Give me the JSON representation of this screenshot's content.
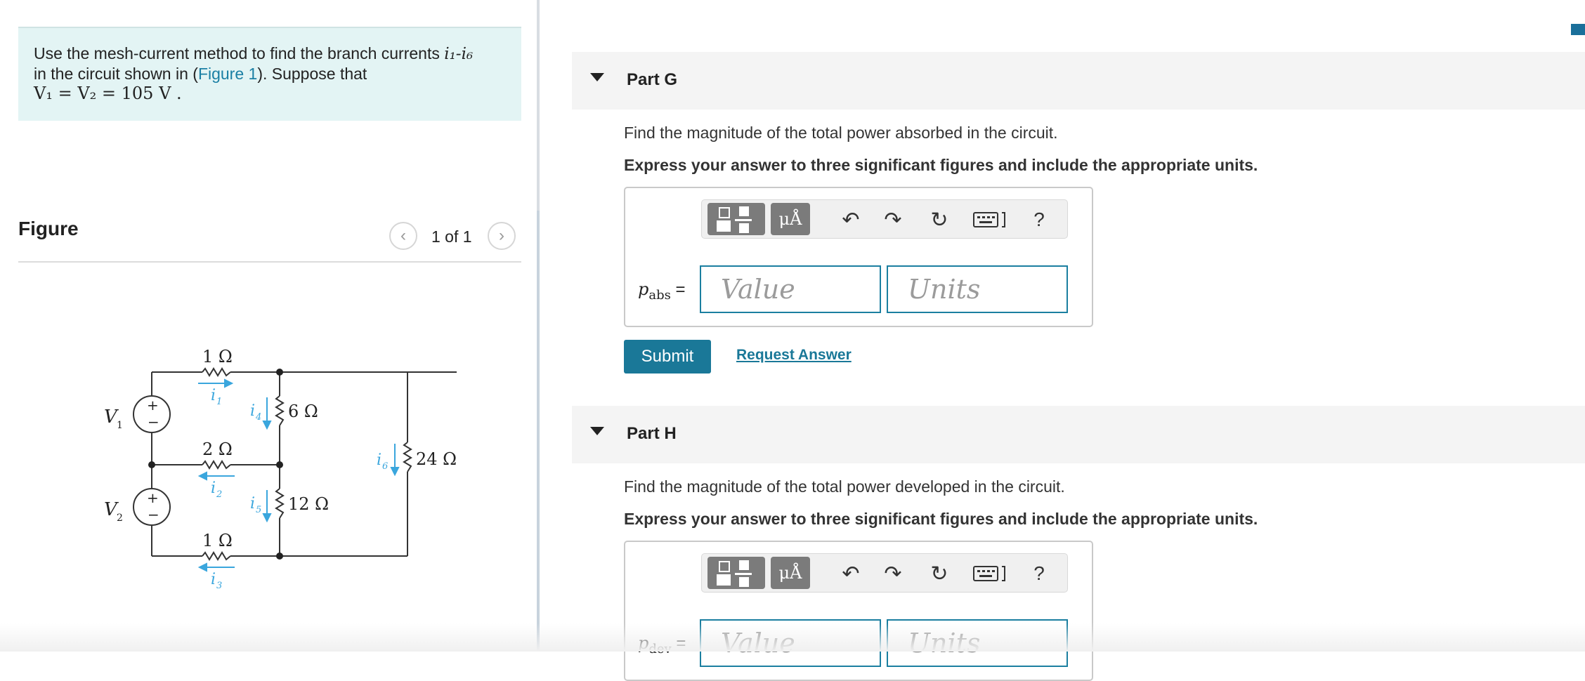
{
  "problem": {
    "text_before": "Use the mesh-current method to find the branch currents ",
    "currents_range": "i₁-i₆",
    "line2_before": "in the circuit shown in (",
    "figure_link": "Figure 1",
    "line2_after": "). Suppose that",
    "condition": "V₁ = V₂ = 105  V ."
  },
  "figure": {
    "title": "Figure",
    "counter": "1 of 1",
    "prev_icon": "chevron-left-icon",
    "next_icon": "chevron-right-icon",
    "circuit": {
      "labels": {
        "r1": "1 Ω",
        "r2": "2 Ω",
        "r3": "1 Ω",
        "r4": "6 Ω",
        "r5": "12 Ω",
        "r6": "24 Ω",
        "v1": "V",
        "v1_sub": "1",
        "v2": "V",
        "v2_sub": "2",
        "i1": "i",
        "i1_sub": "1",
        "i2": "i",
        "i2_sub": "2",
        "i3": "i",
        "i3_sub": "3",
        "i4": "i",
        "i4_sub": "4",
        "i5": "i",
        "i5_sub": "5",
        "i6": "i",
        "i6_sub": "6",
        "plus": "+",
        "minus": "−"
      },
      "colors": {
        "wire": "#333333",
        "current": "#3aa6dd"
      }
    }
  },
  "part_g": {
    "title": "Part G",
    "prompt": "Find the magnitude of the total power absorbed in the circuit.",
    "instruction": "Express your answer to three significant figures and include the appropriate units.",
    "variable": "p",
    "variable_sub": "abs",
    "equals": "=",
    "value_placeholder": "Value",
    "units_placeholder": "Units",
    "submit_label": "Submit",
    "request_label": "Request Answer"
  },
  "part_h": {
    "title": "Part H",
    "prompt": "Find the magnitude of the total power developed in the circuit.",
    "instruction": "Express your answer to three significant figures and include the appropriate units.",
    "variable": "p",
    "variable_sub": "dev",
    "equals": "=",
    "value_placeholder": "Value",
    "units_placeholder": "Units"
  },
  "toolbar": {
    "units_button": "μÅ",
    "undo_icon": "undo-icon",
    "redo_icon": "redo-icon",
    "reset_icon": "reset-icon",
    "keyboard_icon": "keyboard-icon",
    "help": "?"
  },
  "colors": {
    "accent": "#1a7898",
    "problem_bg": "#e3f4f4",
    "link": "#1a7fa4"
  }
}
